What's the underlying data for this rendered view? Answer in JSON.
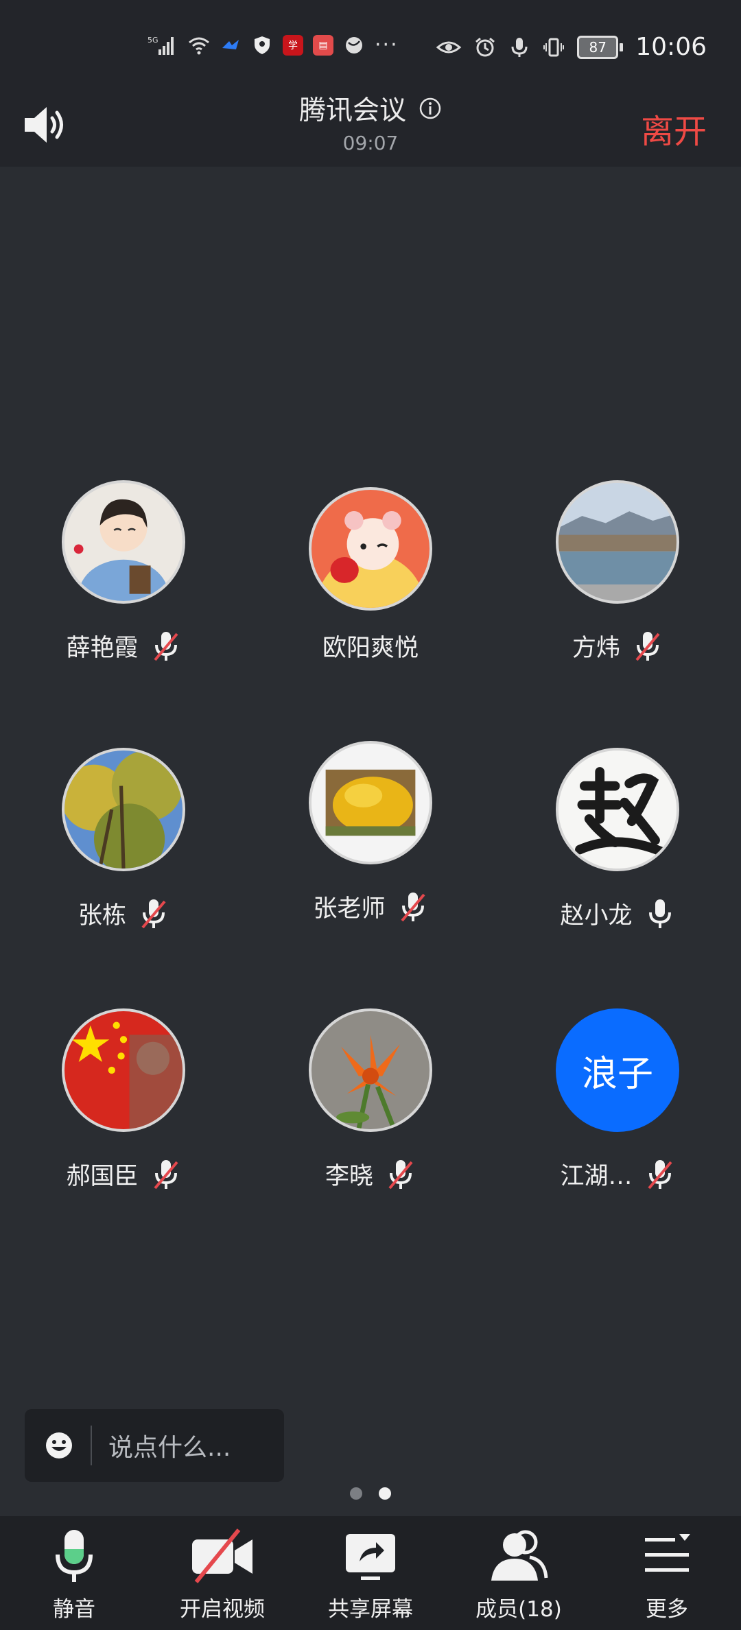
{
  "status_bar": {
    "time": "10:06",
    "battery": "87",
    "network": "5G",
    "more": "···"
  },
  "header": {
    "title": "腾讯会议",
    "timer": "09:07",
    "leave_label": "离开"
  },
  "participants": [
    {
      "name": "薛艳霞",
      "mic": "muted",
      "avatar": "cartoon-girl"
    },
    {
      "name": "欧阳爽悦",
      "mic": "none",
      "avatar": "cartoon-lantern"
    },
    {
      "name": "方炜",
      "mic": "muted",
      "avatar": "landscape-lake"
    },
    {
      "name": "张栋",
      "mic": "muted",
      "avatar": "trees-sky"
    },
    {
      "name": "张老师",
      "mic": "muted",
      "avatar": "yellow-flowers"
    },
    {
      "name": "赵小龙",
      "mic": "on",
      "avatar": "calligraphy-zhao"
    },
    {
      "name": "郝国臣",
      "mic": "muted",
      "avatar": "flag"
    },
    {
      "name": "李晓",
      "mic": "muted",
      "avatar": "lily-flower"
    },
    {
      "name": "江湖…",
      "mic": "muted",
      "avatar_text": "浪子"
    }
  ],
  "chat": {
    "placeholder": "说点什么..."
  },
  "pager": {
    "pages": 2,
    "current": 2
  },
  "toolbar": {
    "mute": "静音",
    "video": "开启视频",
    "share": "共享屏幕",
    "members": "成员(18)",
    "more": "更多"
  },
  "colors": {
    "accent_blue": "#0a6cff",
    "leave_red": "#ef4a45",
    "mic_green": "#5ccf8a",
    "background": "#2a2d32"
  }
}
